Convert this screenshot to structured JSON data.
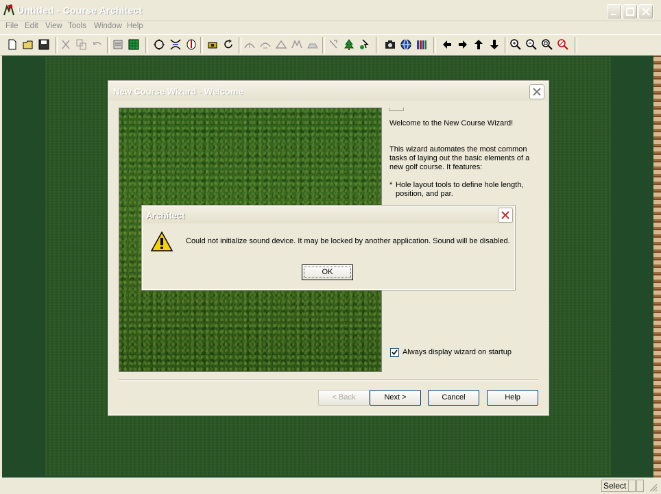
{
  "window": {
    "title": "Untitled - Course Architect"
  },
  "menu": [
    "File",
    "Edit",
    "View",
    "Tools",
    "Window",
    "Help"
  ],
  "toolbar_icons": [
    "new-icon",
    "open-icon",
    "save-icon",
    "cut-icon",
    "copy-icon",
    "undo-icon",
    "properties-icon",
    "grid-icon",
    "circle-tool-icon",
    "bridge-tool-icon",
    "hole-flag-icon",
    "tee-icon",
    "rotate-icon",
    "terrain-raise-icon",
    "terrain-lower-icon",
    "terrain-smooth-icon",
    "terrain-ridge-icon",
    "terrain-flatten-icon",
    "cursor-tool-icon",
    "tree-icon",
    "plant-tool-icon",
    "camera-icon",
    "globe-icon",
    "library-icon",
    "arrow-left-icon",
    "arrow-right-icon",
    "arrow-up-icon",
    "arrow-down-icon",
    "zoom-in-icon",
    "zoom-out-icon",
    "zoom-fit-icon",
    "zoom-reset-icon"
  ],
  "wizard": {
    "title": "New Course Wizard - Welcome",
    "heading": "Welcome to the New Course Wizard!",
    "intro": [
      "This wizard automates the most common",
      "tasks of laying out the basic elements of a",
      "new golf course.  It features:"
    ],
    "bullet1_line1": "Hole layout tools to define hole length,",
    "bullet1_line2": "position, and par.",
    "bullet_marker": "*",
    "checkbox_label": "Always display wizard on startup",
    "buttons": {
      "back": "< Back",
      "next": "Next >",
      "cancel": "Cancel",
      "help": "Help"
    }
  },
  "alert": {
    "title": "Architect",
    "message": "Could not initialize sound device.  It may be locked by another application.  Sound will be disabled.",
    "ok": "OK"
  },
  "status": {
    "mode": "Select"
  }
}
